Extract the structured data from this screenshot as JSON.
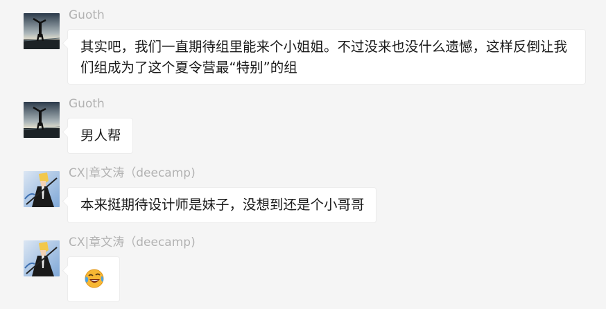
{
  "messages": [
    {
      "sender": "Guoth",
      "avatar": "handstand-sunset-avatar",
      "text": "其实吧，我们一直期待组里能来个小姐姐。不过没来也没什么遗憾，这样反倒让我们组成为了这个夏令营最“特别”的组"
    },
    {
      "sender": "Guoth",
      "avatar": "handstand-sunset-avatar",
      "text": "男人帮"
    },
    {
      "sender": "CX|章文涛（deecamp)",
      "avatar": "anime-character-avatar",
      "text": "本来挺期待设计师是妹子，没想到还是个小哥哥"
    },
    {
      "sender": "CX|章文涛（deecamp)",
      "avatar": "anime-character-avatar",
      "emoji": "laughing-crying-emoji"
    }
  ],
  "colors": {
    "background": "#f5f5f5",
    "bubble": "#ffffff",
    "sender_name": "#b2b2b2",
    "text": "#1a1a1a"
  }
}
